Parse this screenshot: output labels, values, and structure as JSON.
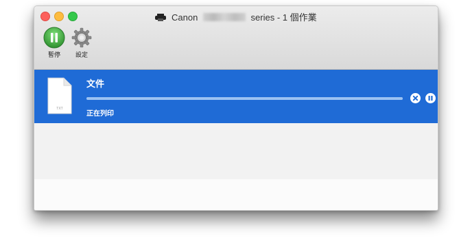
{
  "window": {
    "title_brand": "Canon",
    "title_suffix": "series - 1 個作業"
  },
  "toolbar": {
    "pause_label": "暫停",
    "pause_icon": "pause-icon",
    "settings_label": "設定",
    "settings_icon": "gear-icon"
  },
  "job": {
    "name": "文件",
    "status": "正在列印",
    "progress": 1.0,
    "doc_icon_label": "TXT",
    "delete_icon": "delete-icon",
    "hold_icon": "hold-icon"
  },
  "colors": {
    "selection": "#1f6bd6",
    "pause_green": "#3aa33a",
    "close": "#fc605c",
    "minimize": "#fdbc40",
    "zoom": "#34c84a"
  }
}
